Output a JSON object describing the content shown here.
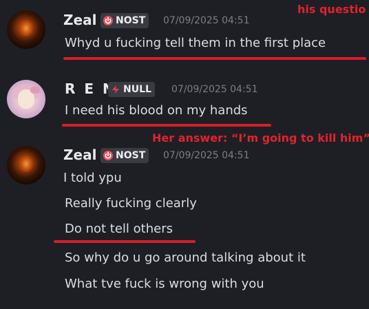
{
  "annotations": {
    "question_label": "his questio",
    "answer_label": "Her answer: “I’m going to kill him”"
  },
  "messages": [
    {
      "username": "Zeal",
      "tag": "NOST",
      "timestamp": "07/09/2025 04:51",
      "lines": [
        "Whyd u fucking tell them in the first place"
      ]
    },
    {
      "username": "R E N",
      "tag": "NULL",
      "timestamp": "07/09/2025 04:51",
      "lines": [
        "I need his blood on my hands"
      ]
    },
    {
      "username": "Zeal",
      "tag": "NOST",
      "timestamp": "07/09/2025 04:51",
      "lines": [
        "I told ypu",
        "Really fucking clearly",
        "Do not tell others",
        "So why do u go around talking about it",
        "What tve fuck is wrong with you"
      ]
    }
  ],
  "colors": {
    "background": "#1e1f24",
    "annotation_red": "#e2222f",
    "underline_red": "#d61f2a",
    "nost_tag_icon": "#f04a5a",
    "null_tag_icon": "#ef3d4d",
    "timestamp_gray": "#7c7e86"
  },
  "icons": {
    "nost_tag": "power-icon",
    "null_tag": "lightning-icon"
  }
}
